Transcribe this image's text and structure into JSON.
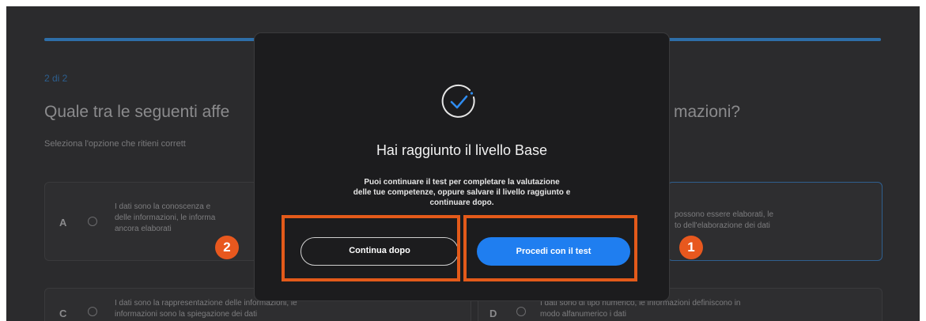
{
  "progress": {
    "value_percent": 100
  },
  "question": {
    "counter": "2 di 2",
    "title_left": "Quale tra le seguenti affe",
    "title_right": "mazioni?",
    "instruction": "Seleziona l'opzione che ritieni corrett"
  },
  "options": {
    "a": {
      "letter": "A",
      "lines": [
        "I dati sono la conoscenza e",
        "delle informazioni, le informa",
        "ancora elaborati"
      ]
    },
    "b": {
      "lines": [
        "possono essere elaborati, le",
        "to dell'elaborazione dei dati"
      ]
    },
    "c": {
      "letter": "C",
      "lines": [
        "I dati sono la rappresentazione delle informazioni, le",
        "informazioni sono la spiegazione dei dati"
      ]
    },
    "d": {
      "letter": "D",
      "lines": [
        "I dati sono di tipo numerico, le informazioni definiscono in",
        "modo alfanumerico i dati"
      ]
    }
  },
  "modal": {
    "icon": "check-circle-icon",
    "title": "Hai raggiunto il livello Base",
    "body_lines": [
      "Puoi continuare il test per completare la valutazione",
      "delle tue competenze, oppure salvare il livello raggiunto e",
      "continuare dopo."
    ],
    "secondary_button": "Continua dopo",
    "primary_button": "Procedi con il test"
  },
  "annotations": {
    "badge_primary": "1",
    "badge_secondary": "2",
    "highlight_color": "#e35a1a"
  },
  "colors": {
    "accent": "#1f7ef0",
    "modal_bg": "#1c1c1e",
    "page_bg": "#2b2b2d"
  }
}
